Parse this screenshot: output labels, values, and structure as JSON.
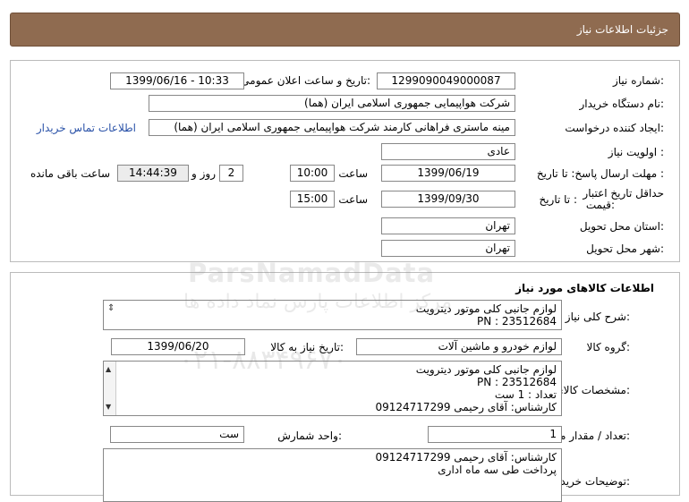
{
  "header": {
    "title": "جزئیات اطلاعات نیاز"
  },
  "need_info": {
    "need_number_label": "شماره نیاز:",
    "need_number": "1299090049000087",
    "announce_label": "تاریخ و ساعت اعلان عمومی:",
    "announce_value": "1399/06/16 - 10:33",
    "buyer_org_label": "نام دستگاه خریدار:",
    "buyer_org": "شرکت هواپیمایی جمهوری اسلامی ایران (هما)",
    "requester_label": "ایجاد کننده درخواست:",
    "requester": "مینه ماستری فراهانی کارمند شرکت هواپیمایی جمهوری اسلامی ایران (هما)",
    "contact_link": "اطلاعات تماس خریدار",
    "priority_label": "اولویت نیاز :",
    "priority": "عادی",
    "deadline_label": "مهلت ارسال پاسخ: تا تاریخ :",
    "deadline_date": "1399/06/19",
    "time_label": "ساعت",
    "deadline_time": "10:00",
    "days_value": "2",
    "days_label": "روز و",
    "remaining_time": "14:44:39",
    "remaining_label": "ساعت باقی مانده",
    "validity_label_1": "حداقل تاریخ اعتبار",
    "validity_label_2": "قیمت:",
    "validity_to_label": "تا تاریخ :",
    "validity_date": "1399/09/30",
    "validity_time_label": "ساعت",
    "validity_time": "15:00",
    "province_label": "استان محل تحویل:",
    "province": "تهران",
    "city_label": "شهر محل تحویل:",
    "city": "تهران"
  },
  "goods_info": {
    "section_title": "اطلاعات کالاهای مورد نیاز",
    "summary_label": "شرح کلی نیاز:",
    "summary_lines": [
      "لوازم جانبی کلی موتور دیترویت",
      "PN : 23512684"
    ],
    "group_label": "گروه کالا:",
    "group_value": "لوازم خودرو و ماشین آلات",
    "need_date_label": "تاریخ نیاز به کالا:",
    "need_date": "1399/06/20",
    "specs_label": "مشخصات کالای مورد نیاز:",
    "specs_lines": [
      "لوازم جانبی کلی موتور دیترویت",
      "PN : 23512684",
      "تعداد : 1 ست",
      "کارشناس: آقای رحیمی 09124717299"
    ],
    "qty_label": "تعداد / مقدار مورد نیاز:",
    "qty": "1",
    "unit_label": "واحد شمارش:",
    "unit": "ست",
    "buyer_notes_label": "توضیحات خریدار:",
    "buyer_notes_lines": [
      "کارشناس: آقای رحیمی 09124717299",
      "پرداخت طی سه ماه اداری"
    ]
  },
  "watermark": {
    "line1": "ParsNamadData",
    "line2": "مرکز اطلاعات پارس نماد داده ها",
    "line3": "۰۲۱-۸۸۳۴۹۶۷۰"
  }
}
